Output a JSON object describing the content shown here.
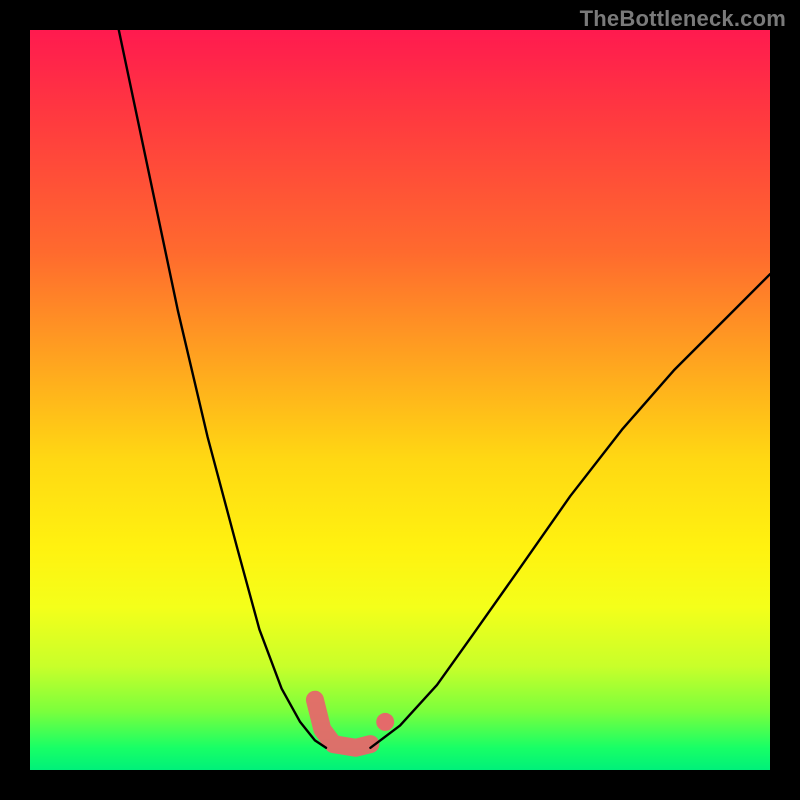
{
  "watermark": "TheBottleneck.com",
  "colors": {
    "curve": "#000000",
    "highlight": "#e46a6a",
    "gradient_stops": [
      "#ff1a4f",
      "#ff3a3f",
      "#ff6a2e",
      "#ffa51f",
      "#ffd813",
      "#fff210",
      "#f4ff1a",
      "#c8ff2a",
      "#7cff3c",
      "#18ff66",
      "#00f07a"
    ]
  },
  "chart_data": {
    "type": "line",
    "title": "",
    "xlabel": "",
    "ylabel": "",
    "xlim": [
      0,
      1
    ],
    "ylim": [
      0,
      1
    ],
    "grid": false,
    "legend": false,
    "series": [
      {
        "name": "left_branch",
        "note": "y ≈ 1 at x≈0.12, steep drop to valley floor (y≈0.03) near x≈0.40; values normalized",
        "x": [
          0.12,
          0.16,
          0.2,
          0.24,
          0.28,
          0.31,
          0.34,
          0.365,
          0.385,
          0.4
        ],
        "y": [
          1.0,
          0.81,
          0.62,
          0.45,
          0.3,
          0.19,
          0.11,
          0.065,
          0.04,
          0.03
        ]
      },
      {
        "name": "right_branch",
        "note": "rises from valley (x≈0.46, y≈0.03) to about y≈0.67 at x=1.0",
        "x": [
          0.46,
          0.5,
          0.55,
          0.6,
          0.66,
          0.73,
          0.8,
          0.87,
          0.94,
          1.0
        ],
        "y": [
          0.03,
          0.06,
          0.115,
          0.185,
          0.27,
          0.37,
          0.46,
          0.54,
          0.61,
          0.67
        ]
      },
      {
        "name": "valley_highlight",
        "note": "flat salmon segment along the green band + left upstroke",
        "x": [
          0.385,
          0.395,
          0.41,
          0.44,
          0.46
        ],
        "y": [
          0.095,
          0.055,
          0.035,
          0.03,
          0.035
        ]
      }
    ],
    "annotations": [
      {
        "name": "valley_outlier_dot",
        "x": 0.48,
        "y": 0.065
      }
    ]
  }
}
